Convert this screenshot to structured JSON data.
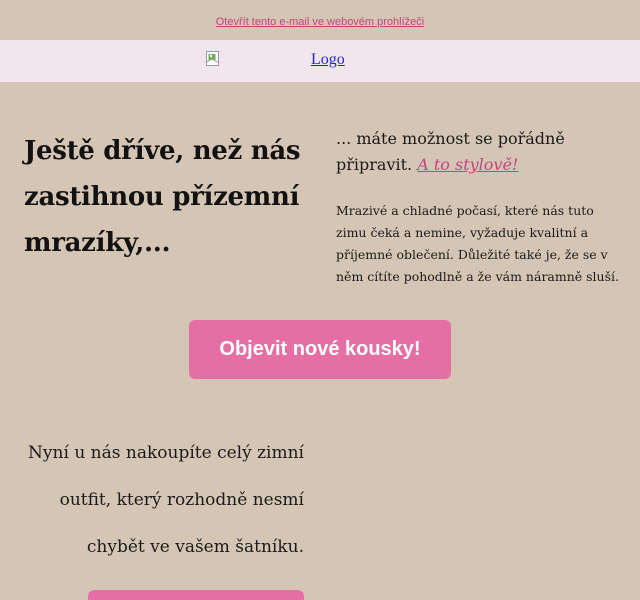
{
  "preheader": {
    "view_in_browser": "Otevřít tento e-mail ve webovém prohlížeči"
  },
  "header": {
    "logo_alt": "Logo"
  },
  "hero": {
    "headline": "Ještě dříve, než nás zastihnou přízemní mrazíky,...",
    "intro_text": "... máte možnost se pořádně připravit.",
    "intro_link": "A to stylově!",
    "body": "Mrazivé a chladné počasí, které nás tuto zimu čeká a nemine, vyžaduje kvalitní a příjemné oblečení. Důležité také je, že se v něm cítíte pohodlně a že vám náramně sluší.",
    "cta_label": "Objevit nové kousky!"
  },
  "outfit": {
    "text": "Nyní u nás nakoupíte celý zimní outfit, který rozhodně nesmí chybět ve vašem šatníku."
  },
  "colors": {
    "background": "#d5c5b4",
    "logo_bar": "#f1e6ee",
    "accent": "#e56fa4",
    "link": "#c2457f"
  }
}
